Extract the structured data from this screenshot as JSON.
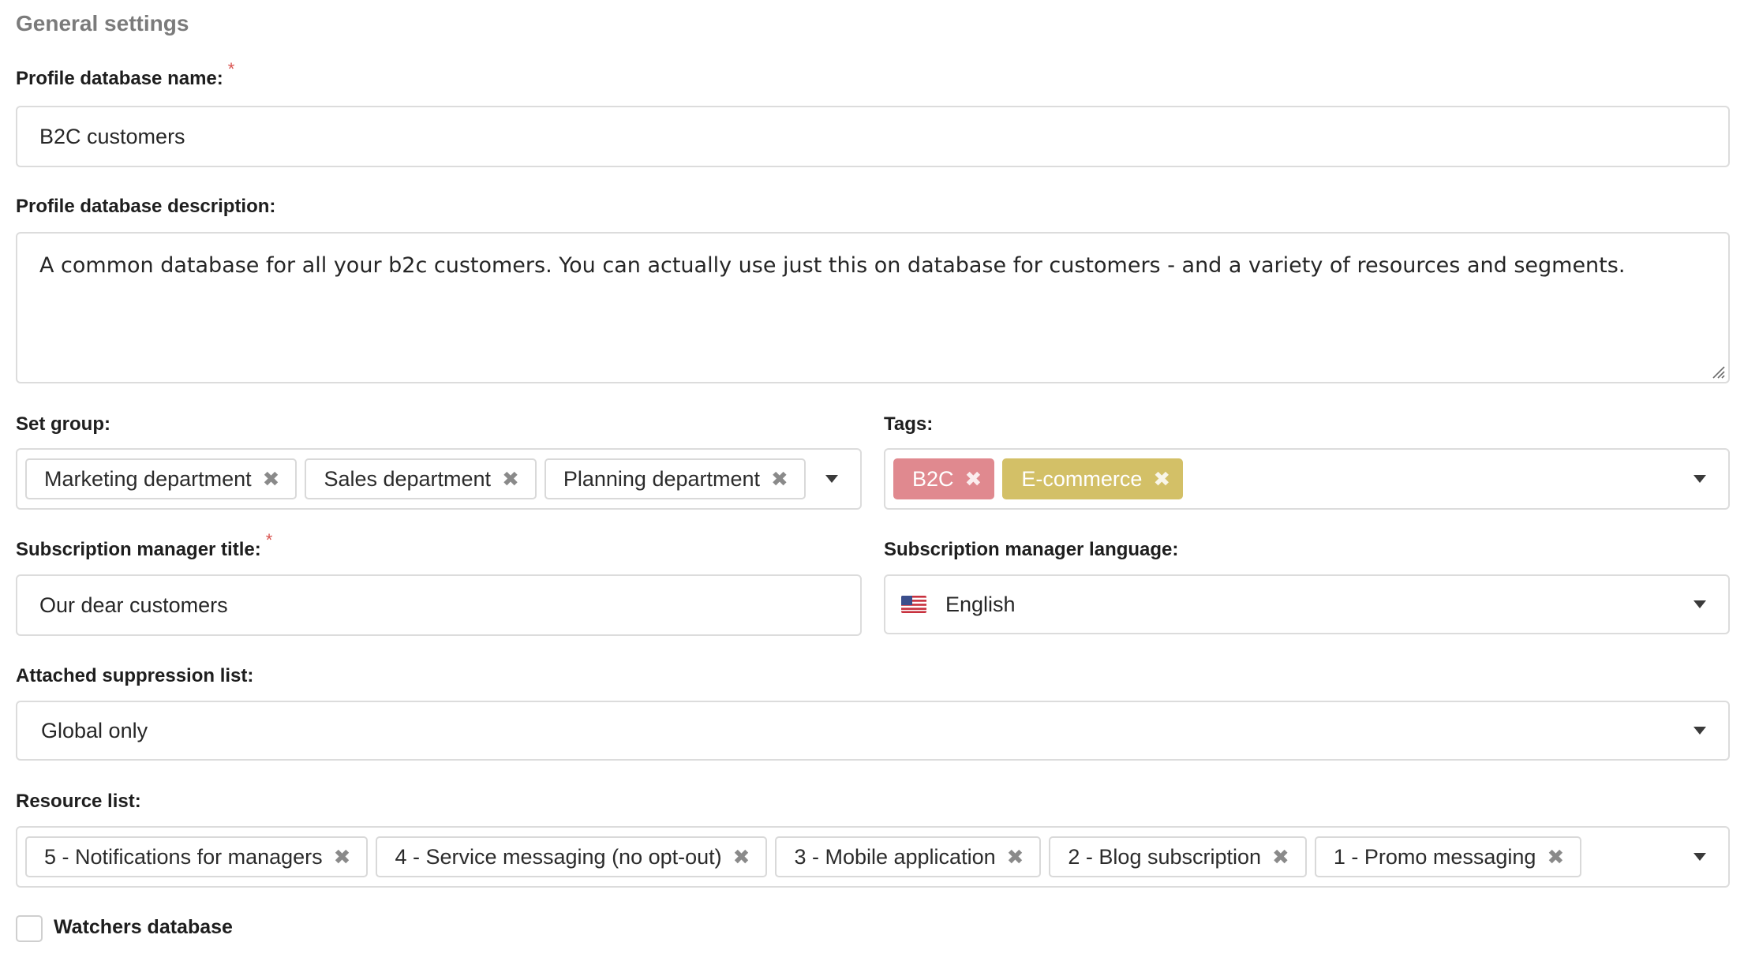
{
  "section": {
    "title": "General settings"
  },
  "profile_name": {
    "label": "Profile database name:",
    "required_mark": "*",
    "value": "B2C customers"
  },
  "profile_description": {
    "label": "Profile database description:",
    "value": "A common database for all your b2c customers. You can actually use just this on database for customers - and a variety of resources and segments."
  },
  "set_group": {
    "label": "Set group:",
    "chips": [
      {
        "label": "Marketing department",
        "remove": "✖"
      },
      {
        "label": "Sales department",
        "remove": "✖"
      },
      {
        "label": "Planning department",
        "remove": "✖"
      }
    ]
  },
  "tags": {
    "label": "Tags:",
    "items": [
      {
        "label": "B2C",
        "remove": "✖",
        "color": "#e0898f"
      },
      {
        "label": "E-commerce",
        "remove": "✖",
        "color": "#d3c067"
      }
    ]
  },
  "subscription_title": {
    "label": "Subscription manager title:",
    "required_mark": "*",
    "value": "Our dear customers"
  },
  "subscription_language": {
    "label": "Subscription manager language:",
    "value": "English",
    "flag_icon": "us-flag-icon"
  },
  "suppression": {
    "label": "Attached suppression list:",
    "value": "Global only"
  },
  "resource_list": {
    "label": "Resource list:",
    "chips": [
      {
        "label": "5 - Notifications for managers",
        "remove": "✖"
      },
      {
        "label": "4 - Service messaging (no opt-out)",
        "remove": "✖"
      },
      {
        "label": "3 - Mobile application",
        "remove": "✖"
      },
      {
        "label": "2 - Blog subscription",
        "remove": "✖"
      },
      {
        "label": "1 - Promo messaging",
        "remove": "✖"
      }
    ]
  },
  "watchers": {
    "label": "Watchers database",
    "checked": false
  },
  "colors": {
    "border": "#dcdcdc",
    "required": "#d9534f",
    "section_title": "#7b7b7b"
  }
}
